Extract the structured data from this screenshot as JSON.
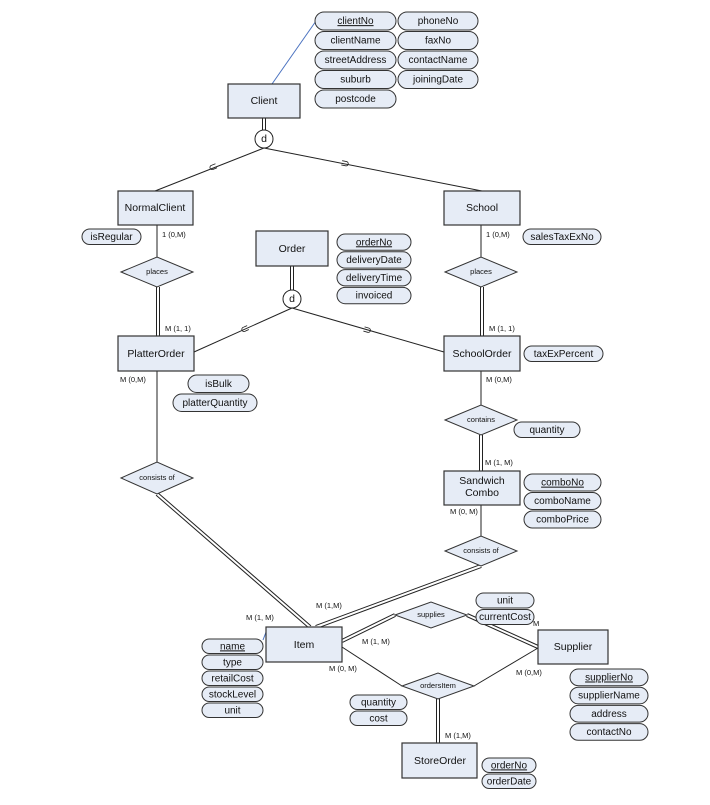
{
  "entities": {
    "client": "Client",
    "normal_client": "NormalClient",
    "school": "School",
    "order": "Order",
    "platter_order": "PlatterOrder",
    "school_order": "SchoolOrder",
    "sandwich_combo": [
      "Sandwich",
      "Combo"
    ],
    "item": "Item",
    "supplier": "Supplier",
    "store_order": "StoreOrder"
  },
  "attributes": {
    "client": [
      "clientNo",
      "clientName",
      "streetAddress",
      "suburb",
      "postcode",
      "phoneNo",
      "faxNo",
      "contactName",
      "joiningDate"
    ],
    "normal_client": [
      "isRegular"
    ],
    "school": [
      "salesTaxExNo"
    ],
    "order": [
      "orderNo",
      "deliveryDate",
      "deliveryTime",
      "invoiced"
    ],
    "school_order": [
      "taxExPercent"
    ],
    "platter_order": [
      "isBulk",
      "platterQuantity"
    ],
    "contains": [
      "quantity"
    ],
    "sandwich_combo": [
      "comboNo",
      "comboName",
      "comboPrice"
    ],
    "item": [
      "name",
      "type",
      "retailCost",
      "stockLevel",
      "unit"
    ],
    "supplies": [
      "unit",
      "currentCost"
    ],
    "orders_item": [
      "quantity",
      "cost"
    ],
    "supplier": [
      "supplierNo",
      "supplierName",
      "address",
      "contactNo"
    ],
    "store_order": [
      "orderNo",
      "orderDate"
    ]
  },
  "relationships": {
    "places_left": "places",
    "places_right": "places",
    "contains": "contains",
    "consists_left": "consists of",
    "consists_right": "consists of",
    "supplies": "supplies",
    "orders_item": "ordersItem"
  },
  "disjoint_symbol": "d",
  "cardinalities": {
    "normal_places": "1 (0,M)",
    "school_places": "1 (0,M)",
    "platter_places": "M (1, 1)",
    "schoolorder_places": "M (1, 1)",
    "platter_consists": "M (0,M)",
    "schoolorder_contains": "M (0,M)",
    "combo_contains": "M (1, M)",
    "combo_consists": "M (0, M)",
    "item_consists_left": "M (1, M)",
    "item_consists_right": "M (1,M)",
    "item_supplies": "M (1, M)",
    "supplier_supplies": "M",
    "item_orders": "M (0, M)",
    "supplier_orders": "M (0,M)",
    "storeorder_orders": "M (1,M)"
  }
}
